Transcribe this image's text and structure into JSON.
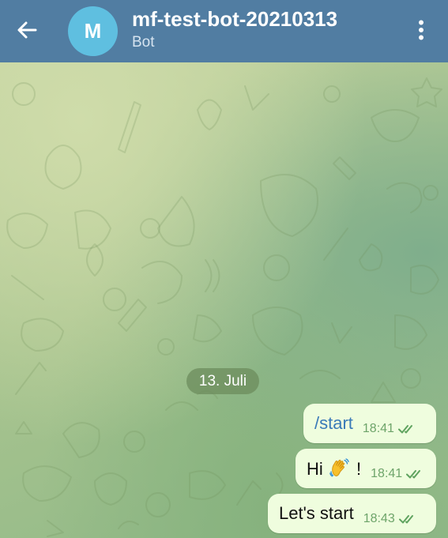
{
  "header": {
    "back_icon": "arrow-left-icon",
    "avatar_letter": "M",
    "title": "mf-test-bot-20210313",
    "subtitle": "Bot",
    "menu_icon": "more-vertical-icon",
    "background_color": "#517da2",
    "avatar_color": "#5fbfe0"
  },
  "chat": {
    "date_separator": "13. Juli",
    "messages": [
      {
        "text": "/start",
        "time": "18:41",
        "status": "read",
        "type": "command"
      },
      {
        "text_before": "Hi",
        "emoji": "waving-hand-icon",
        "text_after": "!",
        "time": "18:41",
        "status": "read"
      },
      {
        "text": "Let's start",
        "time": "18:43",
        "status": "read"
      }
    ],
    "bubble_color": "#effdde",
    "time_color": "#6ea46a",
    "command_color": "#3a7ab8"
  }
}
